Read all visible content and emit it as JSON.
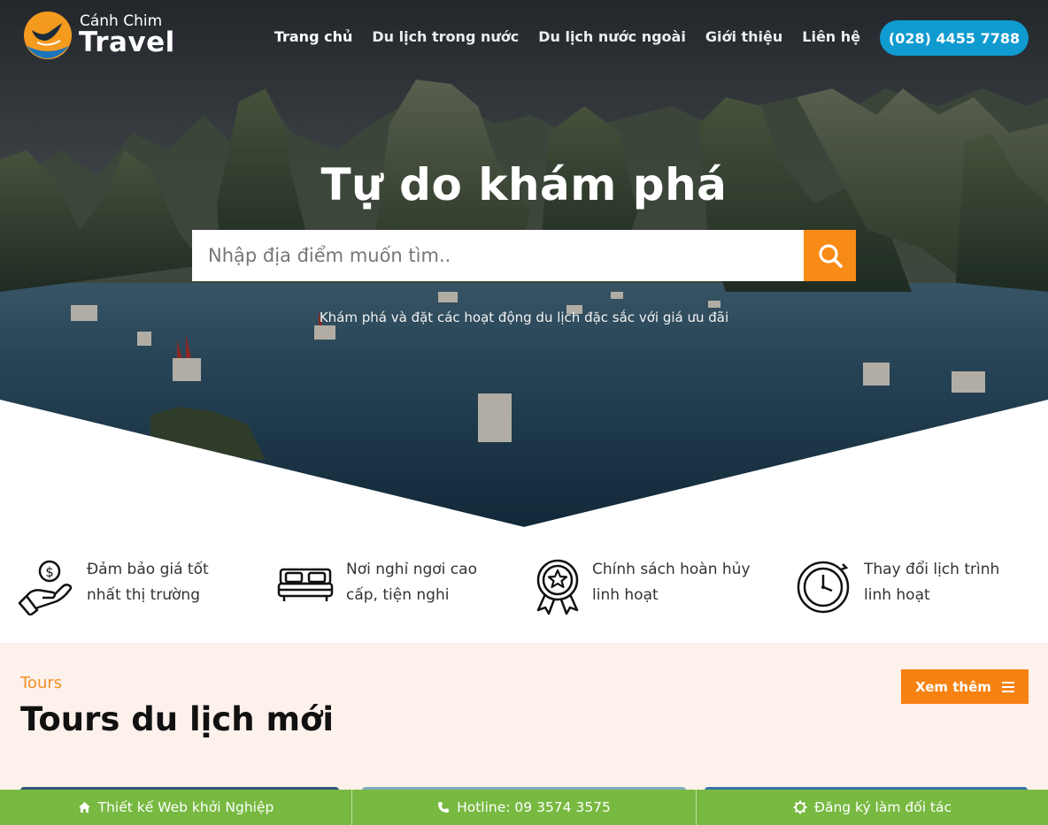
{
  "brand": {
    "small": "Cánh Chim",
    "big": "Travel"
  },
  "nav": {
    "items": [
      {
        "label": "Trang chủ"
      },
      {
        "label": "Du lịch trong nước"
      },
      {
        "label": "Du lịch nước ngoài"
      },
      {
        "label": "Giới thiệu"
      },
      {
        "label": "Liên hệ"
      }
    ],
    "phone": "(028) 4455 7788"
  },
  "hero": {
    "title": "Tự do khám phá",
    "search_placeholder": "Nhập địa điểm muốn tìm..",
    "subtitle": "Khám phá và đặt các hoạt động du lịch đặc sắc với giá ưu đãi"
  },
  "features": [
    {
      "icon": "hand-money-icon",
      "line1": "Đảm bảo giá tốt",
      "line2": "nhất thị trường"
    },
    {
      "icon": "bed-icon",
      "line1": "Nơi nghỉ ngơi cao",
      "line2": "cấp, tiện nghi"
    },
    {
      "icon": "award-star-icon",
      "line1": "Chính sách hoàn hủy",
      "line2": "linh hoạt"
    },
    {
      "icon": "clock-refresh-icon",
      "line1": "Thay đổi lịch trình",
      "line2": "linh hoạt"
    }
  ],
  "tours": {
    "kicker": "Tours",
    "title": "Tours du lịch mới",
    "more_label": "Xem thêm"
  },
  "bottom_bar": [
    {
      "icon": "home-icon",
      "label": "Thiết kế Web khởi Nghiệp"
    },
    {
      "icon": "phone-icon",
      "label": "Hotline: 09 3574 3575"
    },
    {
      "icon": "gear-icon",
      "label": "Đăng ký làm đối tác"
    }
  ],
  "colors": {
    "accent_orange": "#f88b15",
    "phone_blue": "#0f9ad0",
    "bar_green": "#78b941",
    "section_bg": "#fdf1ec"
  }
}
